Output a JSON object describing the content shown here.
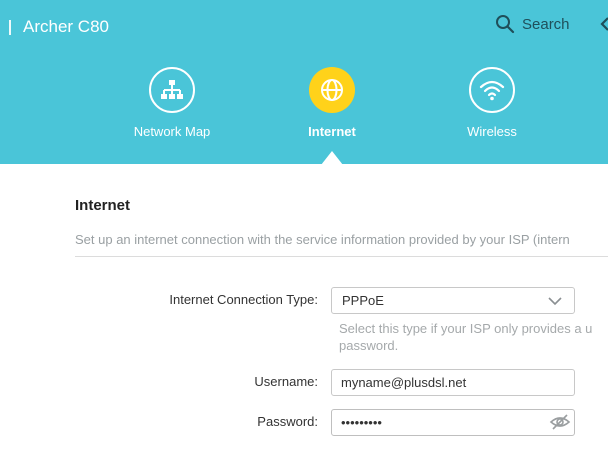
{
  "header": {
    "brand": "Archer C80",
    "search_label": "Search"
  },
  "nav": {
    "items": [
      {
        "label": "Network Map",
        "icon": "network-map-icon"
      },
      {
        "label": "Internet",
        "icon": "globe-icon",
        "active": true
      },
      {
        "label": "Wireless",
        "icon": "wifi-icon"
      }
    ]
  },
  "section": {
    "title": "Internet",
    "description": "Set up an internet connection with the service information provided by your ISP (intern"
  },
  "form": {
    "connection_type_label": "Internet Connection Type:",
    "connection_type_value": "PPPoE",
    "connection_type_hint_line1": "Select this type if your ISP only provides a u",
    "connection_type_hint_line2": "password.",
    "username_label": "Username:",
    "username_value": "myname@plusdsl.net",
    "password_label": "Password:",
    "password_value": "•••••••••"
  },
  "colors": {
    "header_bg": "#4ac5d8",
    "active_nav": "#ffd21a"
  }
}
